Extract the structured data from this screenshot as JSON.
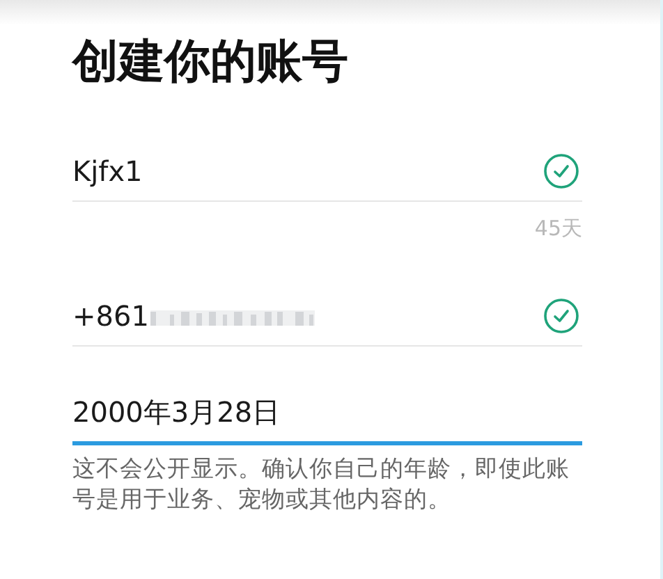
{
  "title": "创建你的账号",
  "fields": [
    {
      "kind": "text",
      "value": "Kjfx1",
      "valid": true,
      "focused": false,
      "counter": "45天"
    },
    {
      "kind": "phone",
      "value": "+861",
      "valid": true,
      "focused": false,
      "redacted": true
    },
    {
      "kind": "date",
      "value": "2000年3月28日",
      "focused": true,
      "helper": "这不会公开显示。确认你自己的年龄，即使此账号是用于业务、宠物或其他内容的。"
    }
  ]
}
